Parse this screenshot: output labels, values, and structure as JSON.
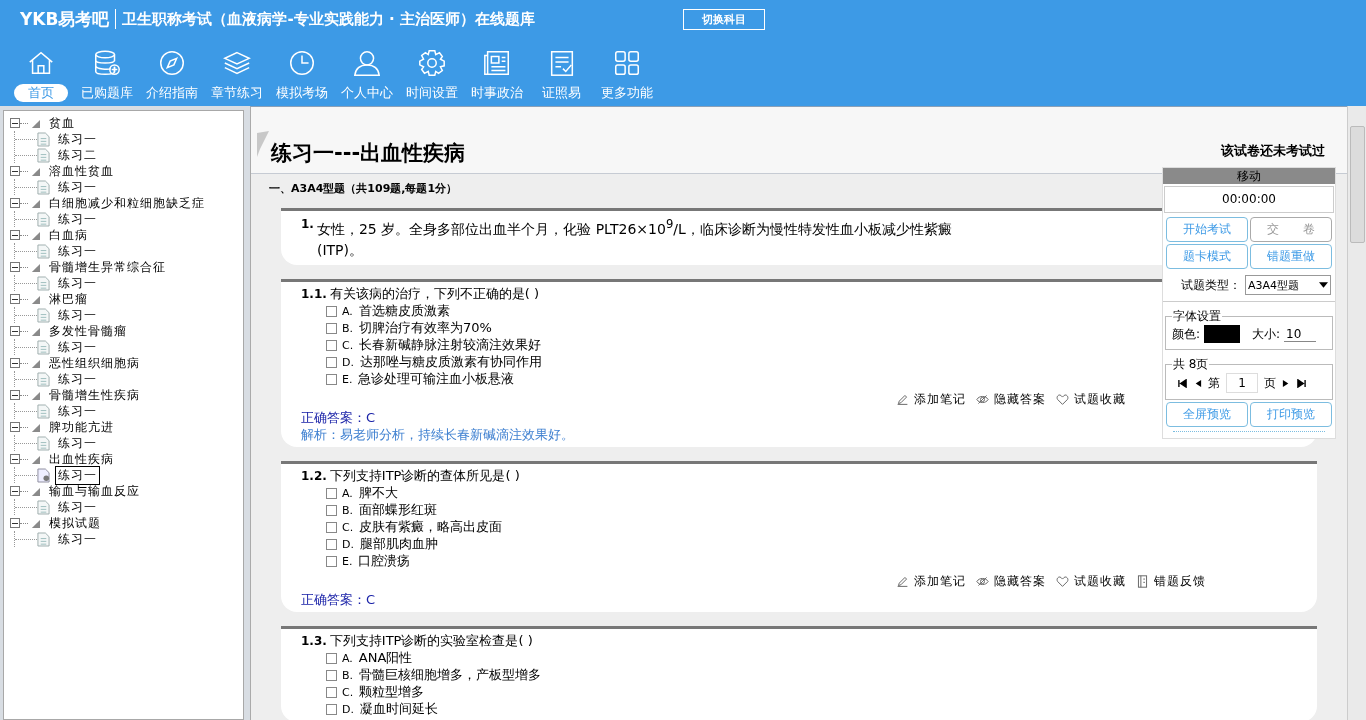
{
  "header": {
    "logo": "YKB易考吧",
    "title": "卫生职称考试（血液病学-专业实践能力 · 主治医师）在线题库",
    "switch_button": "切换科目"
  },
  "nav": [
    {
      "label": "首页",
      "selected": true
    },
    {
      "label": "已购题库",
      "selected": false
    },
    {
      "label": "介绍指南",
      "selected": false
    },
    {
      "label": "章节练习",
      "selected": false
    },
    {
      "label": "模拟考场",
      "selected": false
    },
    {
      "label": "个人中心",
      "selected": false
    },
    {
      "label": "时间设置",
      "selected": false
    },
    {
      "label": "时事政治",
      "selected": false
    },
    {
      "label": "证照易",
      "selected": false
    },
    {
      "label": "更多功能",
      "selected": false
    }
  ],
  "tree": [
    {
      "label": "贫血",
      "expanded": true,
      "children": [
        {
          "label": "练习一",
          "selected": false
        },
        {
          "label": "练习二",
          "selected": false
        }
      ]
    },
    {
      "label": "溶血性贫血",
      "expanded": true,
      "children": [
        {
          "label": "练习一",
          "selected": false
        }
      ]
    },
    {
      "label": "白细胞减少和粒细胞缺乏症",
      "expanded": true,
      "children": [
        {
          "label": "练习一",
          "selected": false
        }
      ]
    },
    {
      "label": "白血病",
      "expanded": true,
      "children": [
        {
          "label": "练习一",
          "selected": false
        }
      ]
    },
    {
      "label": "骨髓增生异常综合征",
      "expanded": true,
      "children": [
        {
          "label": "练习一",
          "selected": false
        }
      ]
    },
    {
      "label": "淋巴瘤",
      "expanded": true,
      "children": [
        {
          "label": "练习一",
          "selected": false
        }
      ]
    },
    {
      "label": "多发性骨髓瘤",
      "expanded": true,
      "children": [
        {
          "label": "练习一",
          "selected": false
        }
      ]
    },
    {
      "label": "恶性组织细胞病",
      "expanded": true,
      "children": [
        {
          "label": "练习一",
          "selected": false
        }
      ]
    },
    {
      "label": "骨髓增生性疾病",
      "expanded": true,
      "children": [
        {
          "label": "练习一",
          "selected": false
        }
      ]
    },
    {
      "label": "脾功能亢进",
      "expanded": true,
      "children": [
        {
          "label": "练习一",
          "selected": false
        }
      ]
    },
    {
      "label": "出血性疾病",
      "expanded": true,
      "children": [
        {
          "label": "练习一",
          "selected": true
        }
      ]
    },
    {
      "label": "输血与输血反应",
      "expanded": true,
      "children": [
        {
          "label": "练习一",
          "selected": false
        }
      ]
    },
    {
      "label": "模拟试题",
      "expanded": true,
      "children": [
        {
          "label": "练习一",
          "selected": false
        }
      ]
    }
  ],
  "paper": {
    "title": "练习一---出血性疾病",
    "status": "该试卷还未考试过",
    "section": "一、A3A4型题（共109题,每题1分）"
  },
  "questions": [
    {
      "kind": "stem",
      "number": "1.",
      "text": "女性，25 岁。全身多部位出血半个月，化验 PLT26×10$^{9}$/L，临床诊断为慢性特发性血小板减少性紫癜(ITP)。"
    },
    {
      "kind": "choice",
      "number": "1.1.",
      "text": "有关该病的治疗，下列不正确的是( )",
      "options": [
        {
          "letter": "A.",
          "text": "首选糖皮质激素",
          "checked": false
        },
        {
          "letter": "B.",
          "text": "切脾治疗有效率为70%",
          "checked": false
        },
        {
          "letter": "C.",
          "text": "长春新碱静脉注射较滴注效果好",
          "checked": false
        },
        {
          "letter": "D.",
          "text": "达那唑与糖皮质激素有协同作用",
          "checked": false
        },
        {
          "letter": "E.",
          "text": "急诊处理可输注血小板悬液",
          "checked": false
        }
      ],
      "actions": [
        "添加笔记",
        "隐藏答案",
        "试题收藏"
      ],
      "answer": "正确答案：C",
      "analysis": "解析：易老师分析，持续长春新碱滴注效果好。"
    },
    {
      "kind": "choice",
      "number": "1.2.",
      "text": "下列支持ITP诊断的查体所见是( )",
      "options": [
        {
          "letter": "A.",
          "text": "脾不大",
          "checked": false
        },
        {
          "letter": "B.",
          "text": "面部蝶形红斑",
          "checked": false
        },
        {
          "letter": "C.",
          "text": "皮肤有紫癜，略高出皮面",
          "checked": false
        },
        {
          "letter": "D.",
          "text": "腿部肌肉血肿",
          "checked": false
        },
        {
          "letter": "E.",
          "text": "口腔溃疡",
          "checked": false
        }
      ],
      "actions": [
        "添加笔记",
        "隐藏答案",
        "试题收藏",
        "错题反馈"
      ],
      "answer": "正确答案：C"
    },
    {
      "kind": "choice",
      "number": "1.3.",
      "text": "下列支持ITP诊断的实验室检查是( )",
      "options": [
        {
          "letter": "A.",
          "text": "ANA阳性",
          "checked": false
        },
        {
          "letter": "B.",
          "text": "骨髓巨核细胞增多，产板型增多",
          "checked": false
        },
        {
          "letter": "C.",
          "text": "颗粒型增多",
          "checked": false
        },
        {
          "letter": "D.",
          "text": "凝血时间延长",
          "checked": false
        }
      ]
    }
  ],
  "panel": {
    "title": "移动",
    "timer": "00:00:00",
    "buttons": [
      {
        "label": "开始考试",
        "disabled": false
      },
      {
        "label": "交　　卷",
        "disabled": true
      },
      {
        "label": "题卡模式",
        "disabled": false
      },
      {
        "label": "错题重做",
        "disabled": false
      }
    ],
    "type_label": "试题类型：",
    "type_value": "A3A4型题",
    "font_legend": "字体设置",
    "color_label": "颜色:",
    "swatch": {
      "color": "#000000"
    },
    "size_label": "大小:",
    "size_value": "10",
    "pages_legend": "共 8页",
    "page_prefix": "第",
    "page_value": "1",
    "page_suffix": "页",
    "bottom_buttons": [
      "全屏预览",
      "打印预览"
    ]
  }
}
